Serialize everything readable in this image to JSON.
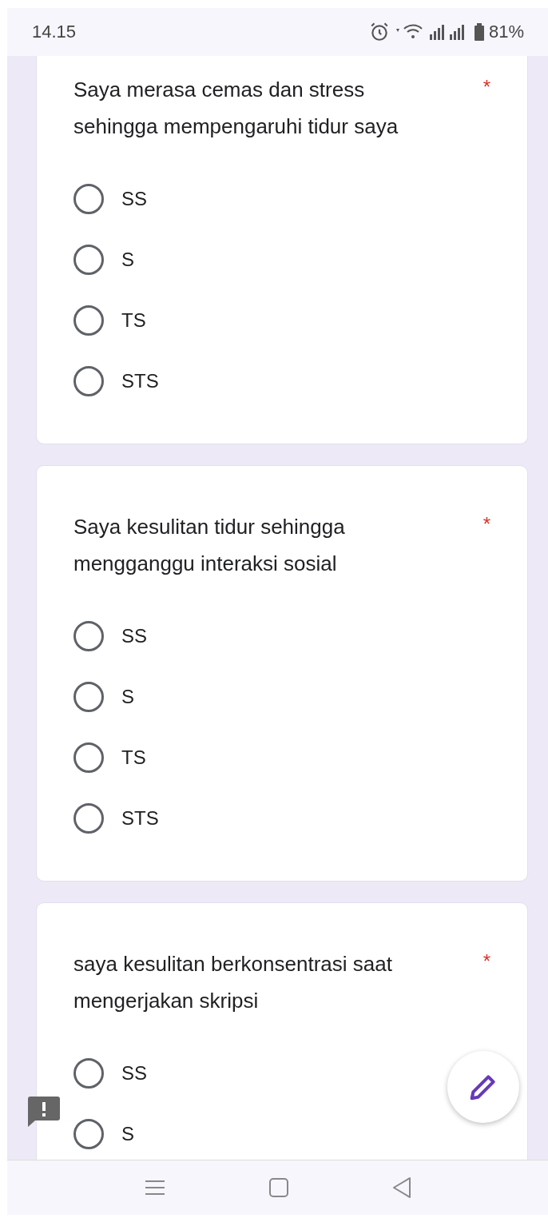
{
  "status_bar": {
    "time": "14.15",
    "battery": "81%"
  },
  "questions": [
    {
      "text": "Saya merasa cemas dan stress sehingga mempengaruhi tidur saya",
      "required_mark": "*",
      "options": [
        {
          "label": "SS",
          "selected": false
        },
        {
          "label": "S",
          "selected": false
        },
        {
          "label": "TS",
          "selected": false
        },
        {
          "label": "STS",
          "selected": false
        }
      ]
    },
    {
      "text": "Saya kesulitan tidur sehingga mengganggu interaksi sosial",
      "required_mark": "*",
      "options": [
        {
          "label": "SS",
          "selected": false
        },
        {
          "label": "S",
          "selected": false
        },
        {
          "label": "TS",
          "selected": false
        },
        {
          "label": "STS",
          "selected": false
        }
      ]
    },
    {
      "text": "saya kesulitan berkonsentrasi saat mengerjakan skripsi",
      "required_mark": "*",
      "options": [
        {
          "label": "SS",
          "selected": false
        },
        {
          "label": "S",
          "selected": false
        }
      ]
    }
  ]
}
